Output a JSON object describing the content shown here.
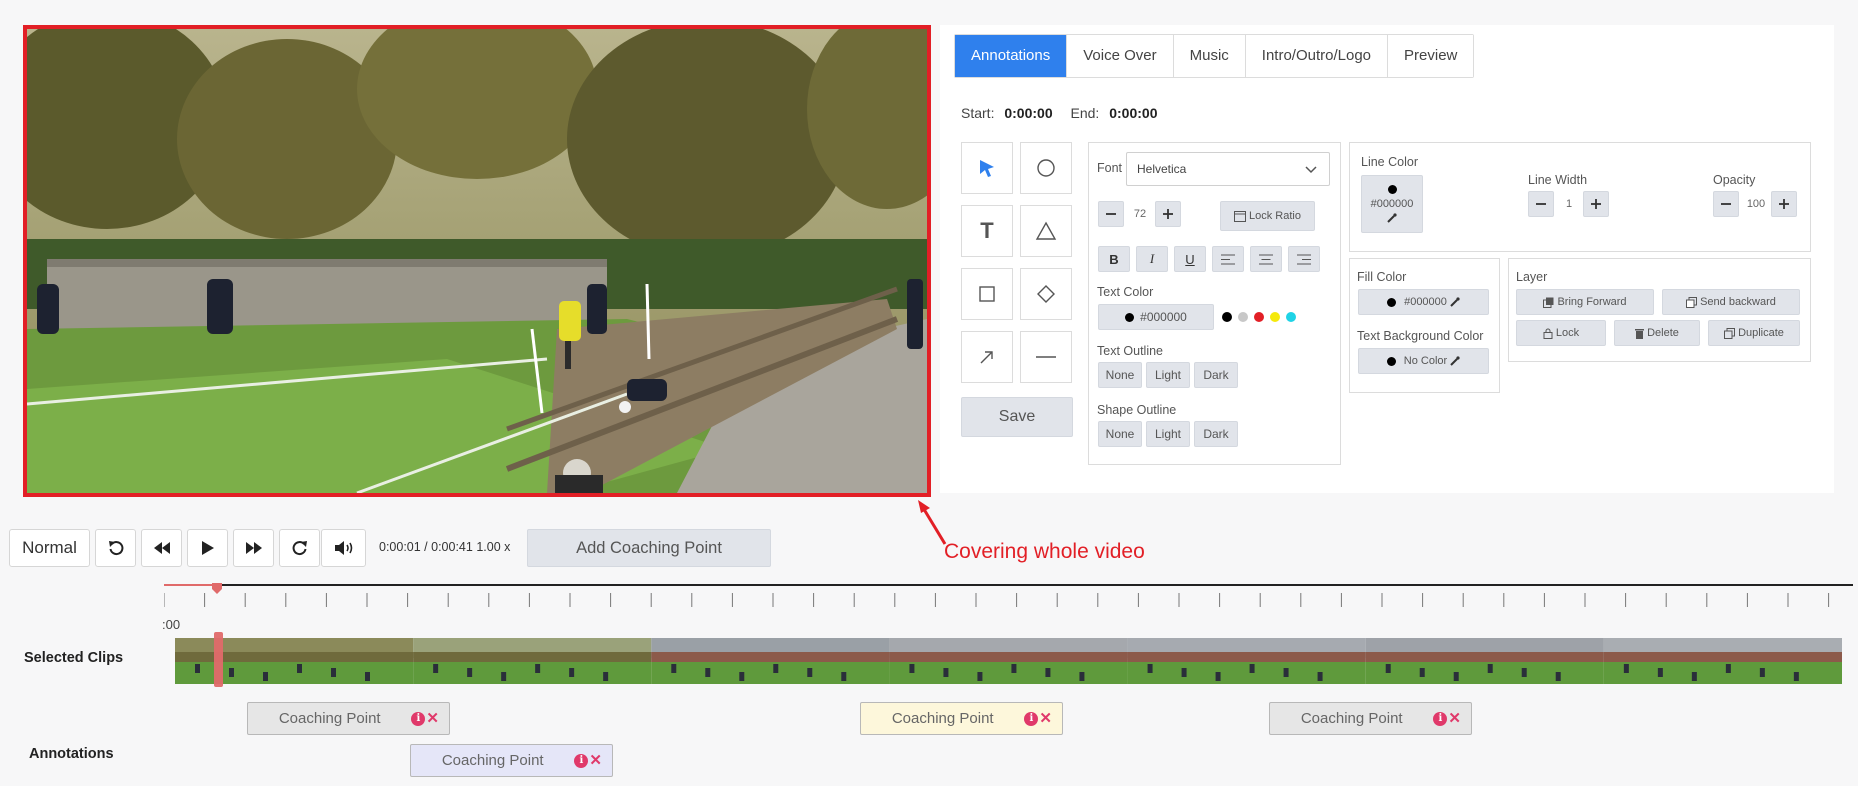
{
  "tabs": [
    "Annotations",
    "Voice Over",
    "Music",
    "Intro/Outro/Logo",
    "Preview"
  ],
  "active_tab": "Annotations",
  "times": {
    "start_label": "Start:",
    "start_value": "0:00:00",
    "end_label": "End:",
    "end_value": "0:00:00"
  },
  "tools": {
    "text_glyph": "T",
    "save_label": "Save"
  },
  "font": {
    "label": "Font",
    "value": "Helvetica",
    "size": "72",
    "lock_ratio_label": "Lock Ratio"
  },
  "format": {
    "bold": "B",
    "italic": "I",
    "underline": "U"
  },
  "text_color": {
    "label": "Text Color",
    "value": "#000000",
    "swatches": [
      "#000000",
      "#c8c8c8",
      "#e21f26",
      "#f5e90b",
      "#1fd3e6"
    ]
  },
  "text_outline": {
    "label": "Text Outline",
    "options": [
      "None",
      "Light",
      "Dark"
    ]
  },
  "shape_outline": {
    "label": "Shape Outline",
    "options": [
      "None",
      "Light",
      "Dark"
    ]
  },
  "line_color": {
    "label": "Line Color",
    "value": "#000000"
  },
  "line_width": {
    "label": "Line Width",
    "value": "1"
  },
  "opacity": {
    "label": "Opacity",
    "value": "100"
  },
  "fill_color": {
    "label": "Fill Color",
    "value": "#000000"
  },
  "text_bg_color": {
    "label": "Text Background Color",
    "value": "No Color"
  },
  "layer": {
    "label": "Layer",
    "bring_forward": "Bring Forward",
    "send_backward": "Send backward",
    "lock": "Lock",
    "delete": "Delete",
    "duplicate": "Duplicate"
  },
  "player": {
    "speed": "Normal",
    "time": "0:00:01 / 0:00:41",
    "rate": "1.00 x",
    "add_coaching_point": "Add Coaching Point"
  },
  "callout": "Covering whole video",
  "timeline": {
    "start_label": ":00",
    "selected_clips_label": "Selected Clips",
    "annotations_label": "Annotations",
    "info_glyph": "i",
    "remove_glyph": "✕",
    "coaching_points": [
      {
        "label": "Coaching Point",
        "bg": "#e6e6e6"
      },
      {
        "label": "Coaching Point",
        "bg": "#fdf7db"
      },
      {
        "label": "Coaching Point",
        "bg": "#e6e6e6"
      },
      {
        "label": "Coaching Point",
        "bg": "#e5e6f8"
      }
    ]
  },
  "colors": {
    "accent": "#2f80ed",
    "callout_red": "#e21f26",
    "remove_pink": "#e0396a"
  }
}
